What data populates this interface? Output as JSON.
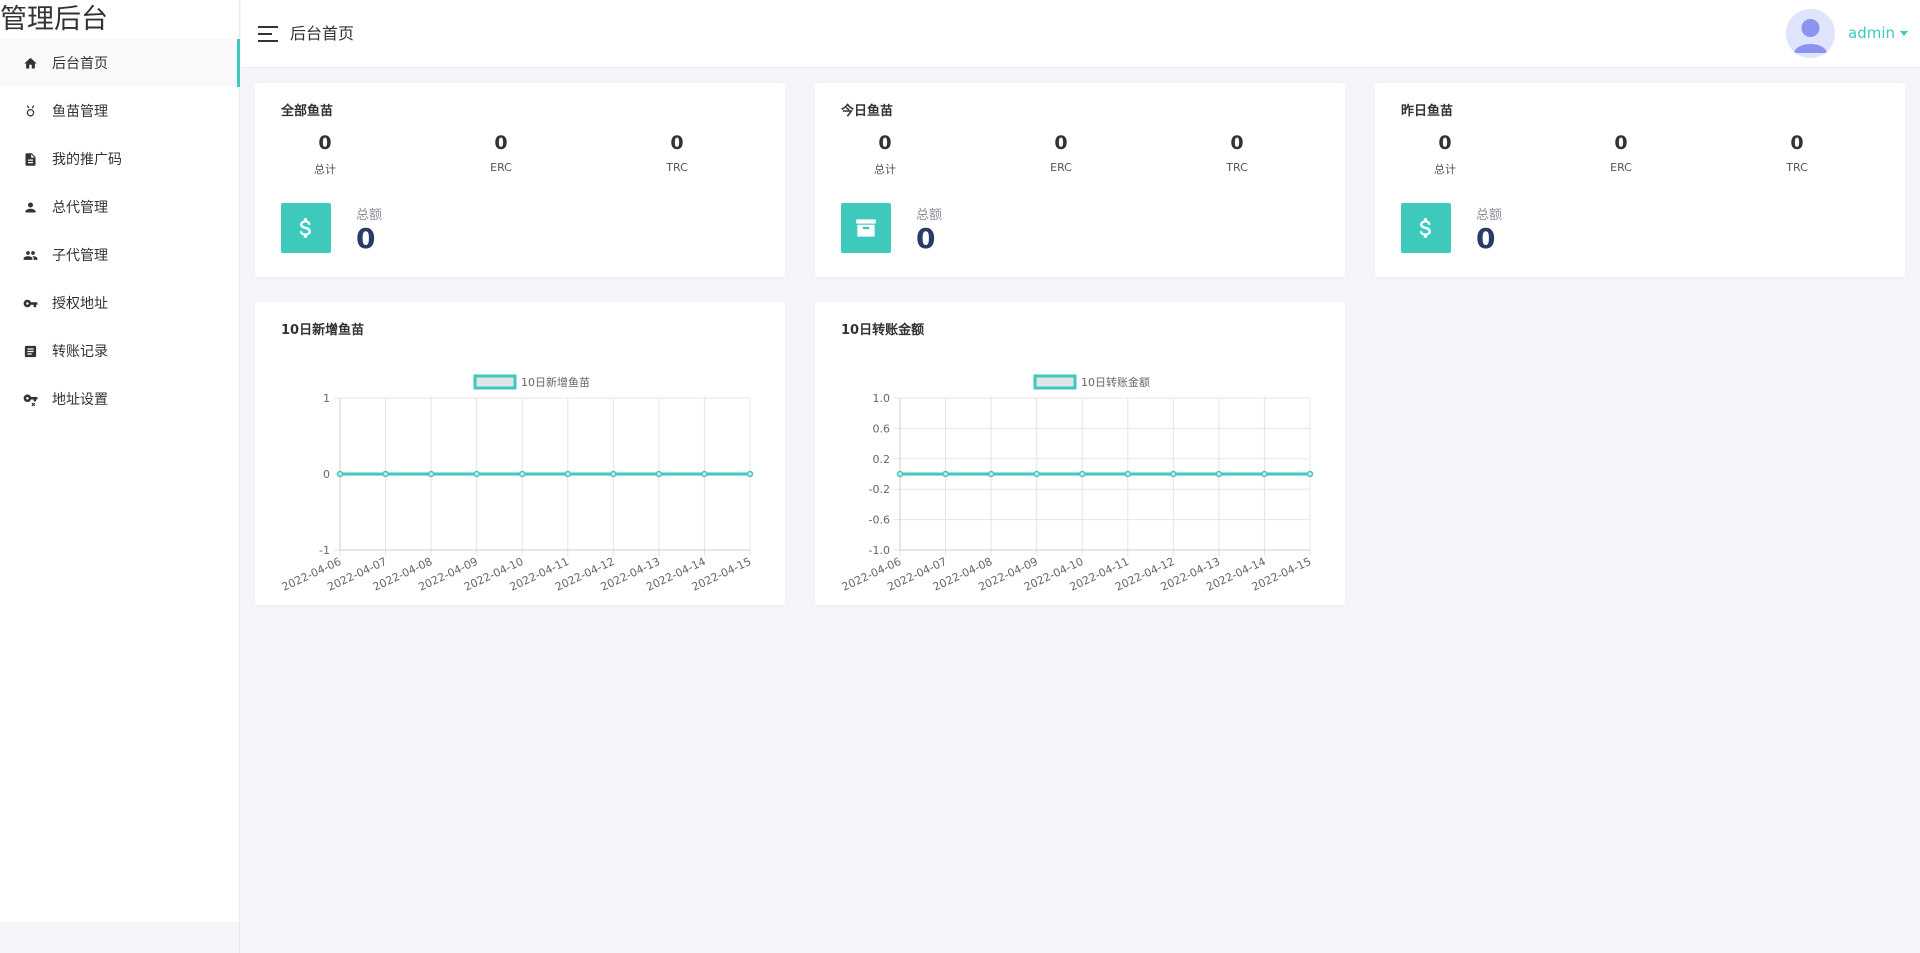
{
  "brand": "管理后台",
  "sidebar": {
    "items": [
      {
        "label": "后台首页",
        "icon": "home-icon"
      },
      {
        "label": "鱼苗管理",
        "icon": "fish-icon"
      },
      {
        "label": "我的推广码",
        "icon": "document-icon"
      },
      {
        "label": "总代管理",
        "icon": "person-icon"
      },
      {
        "label": "子代管理",
        "icon": "people-icon"
      },
      {
        "label": "授权地址",
        "icon": "key-icon"
      },
      {
        "label": "转账记录",
        "icon": "list-icon"
      },
      {
        "label": "地址设置",
        "icon": "key-settings-icon"
      }
    ]
  },
  "header": {
    "title": "后台首页",
    "username": "admin"
  },
  "colors": {
    "accent": "#3ec9bd",
    "total_value": "#2b3a67"
  },
  "stat_cards": [
    {
      "title": "全部鱼苗",
      "stats": [
        {
          "value": "0",
          "label": "总计"
        },
        {
          "value": "0",
          "label": "ERC"
        },
        {
          "value": "0",
          "label": "TRC"
        }
      ],
      "total_label": "总额",
      "total_value": "0",
      "icon": "dollar-icon"
    },
    {
      "title": "今日鱼苗",
      "stats": [
        {
          "value": "0",
          "label": "总计"
        },
        {
          "value": "0",
          "label": "ERC"
        },
        {
          "value": "0",
          "label": "TRC"
        }
      ],
      "total_label": "总额",
      "total_value": "0",
      "icon": "archive-icon"
    },
    {
      "title": "昨日鱼苗",
      "stats": [
        {
          "value": "0",
          "label": "总计"
        },
        {
          "value": "0",
          "label": "ERC"
        },
        {
          "value": "0",
          "label": "TRC"
        }
      ],
      "total_label": "总额",
      "total_value": "0",
      "icon": "dollar-icon"
    }
  ],
  "chart_cards": [
    {
      "title": "10日新增鱼苗"
    },
    {
      "title": "10日转账金额"
    }
  ],
  "chart_data": [
    {
      "type": "line",
      "title": "10日新增鱼苗",
      "categories": [
        "2022-04-06",
        "2022-04-07",
        "2022-04-08",
        "2022-04-09",
        "2022-04-10",
        "2022-04-11",
        "2022-04-12",
        "2022-04-13",
        "2022-04-14",
        "2022-04-15"
      ],
      "series": [
        {
          "name": "10日新增鱼苗",
          "values": [
            0,
            0,
            0,
            0,
            0,
            0,
            0,
            0,
            0,
            0
          ]
        }
      ],
      "ylim": [
        -1,
        1
      ],
      "yticks": [
        "1",
        "0",
        "-1"
      ],
      "grid": true,
      "legend": "top-center",
      "xlabel": "",
      "ylabel": ""
    },
    {
      "type": "line",
      "title": "10日转账金额",
      "categories": [
        "2022-04-06",
        "2022-04-07",
        "2022-04-08",
        "2022-04-09",
        "2022-04-10",
        "2022-04-11",
        "2022-04-12",
        "2022-04-13",
        "2022-04-14",
        "2022-04-15"
      ],
      "series": [
        {
          "name": "10日转账金额",
          "values": [
            0,
            0,
            0,
            0,
            0,
            0,
            0,
            0,
            0,
            0
          ]
        }
      ],
      "ylim": [
        -1,
        1
      ],
      "yticks": [
        "1.0",
        "0.6",
        "0.2",
        "-0.2",
        "-0.6",
        "-1.0"
      ],
      "grid": true,
      "legend": "top-center",
      "xlabel": "",
      "ylabel": ""
    }
  ]
}
